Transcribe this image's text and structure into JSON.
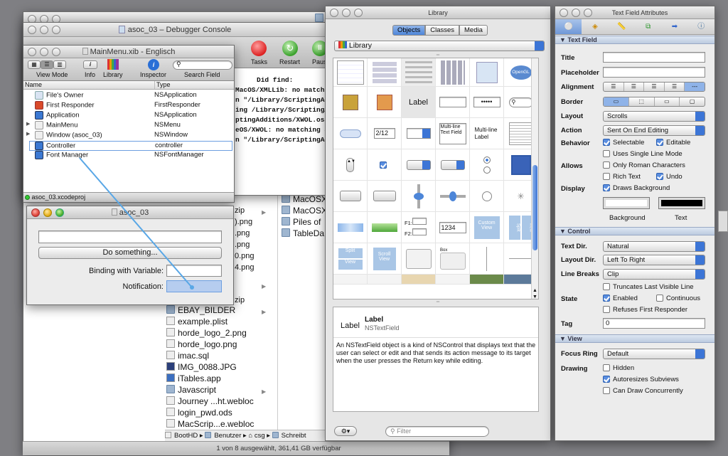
{
  "debugger": {
    "title": "asoc_03 – Debugger Console",
    "toolbar": [
      "Tasks",
      "Restart",
      "Paus"
    ],
    "console": [
      "Did find:",
      "MacOS/XMLLib: no matching",
      "n \"/Library/ScriptingAdd",
      "ing /Library/ScriptingA",
      "ptingAdditions/XWOL.osa",
      "eOS/XWOL: no matching ar",
      "n \"/Library/ScriptingAd"
    ]
  },
  "xib": {
    "title": "MainMenu.xib - Englisch",
    "toolbar": [
      "View Mode",
      "Info",
      "Library",
      "Inspector",
      "Search Field"
    ],
    "col_name": "Name",
    "col_type": "Type",
    "rows": [
      {
        "name": "File's Owner",
        "type": "NSApplication"
      },
      {
        "name": "First Responder",
        "type": "FirstResponder"
      },
      {
        "name": "Application",
        "type": "NSApplication"
      },
      {
        "name": "MainMenu",
        "type": "NSMenu"
      },
      {
        "name": "Window (asoc_03)",
        "type": "NSWindow"
      },
      {
        "name": "Controller",
        "type": "controller"
      },
      {
        "name": "Font Manager",
        "type": "NSFontManager"
      }
    ],
    "status": "asoc_03.xcodeproj"
  },
  "asoc": {
    "title": "asoc_03",
    "button": "Do something...",
    "binding_label": "Binding with Variable:",
    "notification_label": "Notification:"
  },
  "finder": {
    "items_right": [
      "zip",
      ").png",
      ".png",
      ".png",
      "0.png",
      "4.png",
      "zip"
    ],
    "items_left_top": [
      "MacOSX",
      "MacOSX",
      "Piles of",
      "TableDa"
    ],
    "items": [
      "EBAY_BILDER",
      "example.plist",
      "horde_logo_2.png",
      "horde_logo.png",
      "imac.sql",
      "IMG_0088.JPG",
      "iTables.app",
      "Javascript",
      "Journey ...ht.webloc",
      "login_pwd.ods",
      "MacScrip...e.webloc"
    ],
    "path": [
      "BootHD",
      "Benutzer",
      "csg",
      "Schreibt"
    ],
    "status": "1 von 8 ausgewählt, 361,41 GB verfügbar"
  },
  "library": {
    "title": "Library",
    "tabs": [
      "Objects",
      "Classes",
      "Media"
    ],
    "popup": "Library",
    "grid_texts": {
      "label": "Label",
      "multiline": "Multi-line Text Field",
      "multiline2": "Multi-line Label",
      "stepper": "2/12",
      "split": "Split",
      "view": "View",
      "custom": "Custom View",
      "scroll": "Scroll View",
      "box": "Box",
      "f1": "F1:",
      "f2": "F2:",
      "num": "1234",
      "opengl": "OpenGL",
      "password": "•••••"
    },
    "detail_label": "Label",
    "detail_name": "Label",
    "detail_class": "NSTextField",
    "description": "An NSTextField object is a kind of NSControl that displays text that the user can select or edit and that sends its action message to its target when the user presses the Return key while editing.",
    "filter_placeholder": "Filter"
  },
  "inspector": {
    "title": "Text Field Attributes",
    "sec_textfield": "Text Field",
    "sec_control": "Control",
    "sec_view": "View",
    "labels": {
      "title": "Title",
      "placeholder": "Placeholder",
      "alignment": "Alignment",
      "border": "Border",
      "layout": "Layout",
      "action": "Action",
      "behavior": "Behavior",
      "allows": "Allows",
      "display": "Display",
      "textdir": "Text Dir.",
      "layoutdir": "Layout Dir.",
      "linebreaks": "Line Breaks",
      "state": "State",
      "tag": "Tag",
      "focusring": "Focus Ring",
      "drawing": "Drawing"
    },
    "layout_val": "Scrolls",
    "action_val": "Sent On End Editing",
    "checks": {
      "selectable": "Selectable",
      "editable": "Editable",
      "single_line": "Uses Single Line Mode",
      "only_roman": "Only Roman Characters",
      "rich_text": "Rich Text",
      "undo": "Undo",
      "draws_bg": "Draws Background",
      "truncates": "Truncates Last Visible Line",
      "enabled": "Enabled",
      "continuous": "Continuous",
      "refuses": "Refuses First Responder",
      "hidden": "Hidden",
      "autoresizes": "Autoresizes Subviews",
      "concurrently": "Can Draw Concurrently"
    },
    "background": "Background",
    "text": "Text",
    "textdir_val": "Natural",
    "layoutdir_val": "Left To Right",
    "linebreaks_val": "Clip",
    "tag_val": "0",
    "focusring_val": "Default"
  },
  "colors": {
    "accent": "#3c75d6",
    "selection": "#b6cdef",
    "connection": "#59a7e6"
  }
}
